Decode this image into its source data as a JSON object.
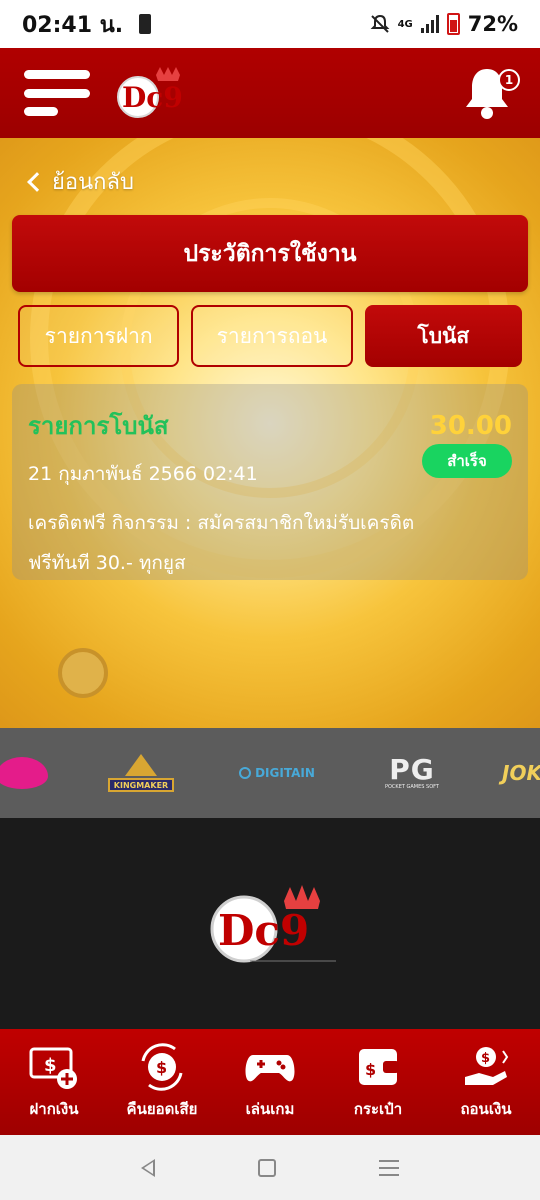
{
  "status_bar": {
    "time": "02:41 น.",
    "network": "4G",
    "battery": "72%",
    "icons": [
      "battery-saver-icon",
      "mute-icon",
      "signal-icon",
      "battery-icon"
    ]
  },
  "header": {
    "logo_text": "Dc9",
    "notification_count": "1",
    "icons": [
      "menu-icon",
      "bell-icon"
    ]
  },
  "nav": {
    "back_label": "ย้อนกลับ"
  },
  "page": {
    "title": "ประวัติการใช้งาน"
  },
  "tabs": [
    {
      "label": "รายการฝาก",
      "active": false
    },
    {
      "label": "รายการถอน",
      "active": false
    },
    {
      "label": "โบนัส",
      "active": true
    }
  ],
  "transaction": {
    "type": "รายการโบนัส",
    "amount": "30.00",
    "date": "21 กุมภาพันธ์ 2566 02:41",
    "status": "สำเร็จ",
    "description": "เครดิตฟรี กิจกรรม : สมัครสมาชิกใหม่รับเครดิตฟรีทันที 30.- ทุกยูส"
  },
  "providers": {
    "kingmaker": "KINGMAKER",
    "digitain": "DIGITAIN",
    "pg": "PG",
    "pg_sub": "POCKET GAMES SOFT",
    "joker": "JOK"
  },
  "footer": {
    "logo_text": "Dc9"
  },
  "bottom_nav": [
    {
      "label": "ฝากเงิน",
      "icon": "deposit-icon"
    },
    {
      "label": "คืนยอดเสีย",
      "icon": "cashback-icon"
    },
    {
      "label": "เล่นเกม",
      "icon": "gamepad-icon"
    },
    {
      "label": "กระเป๋า",
      "icon": "wallet-icon"
    },
    {
      "label": "ถอนเงิน",
      "icon": "withdraw-icon"
    }
  ],
  "colors": {
    "brand_red": "#b00000",
    "success_green": "#19d460",
    "label_green": "#23c15a",
    "amount_gold": "#ffd23a"
  }
}
